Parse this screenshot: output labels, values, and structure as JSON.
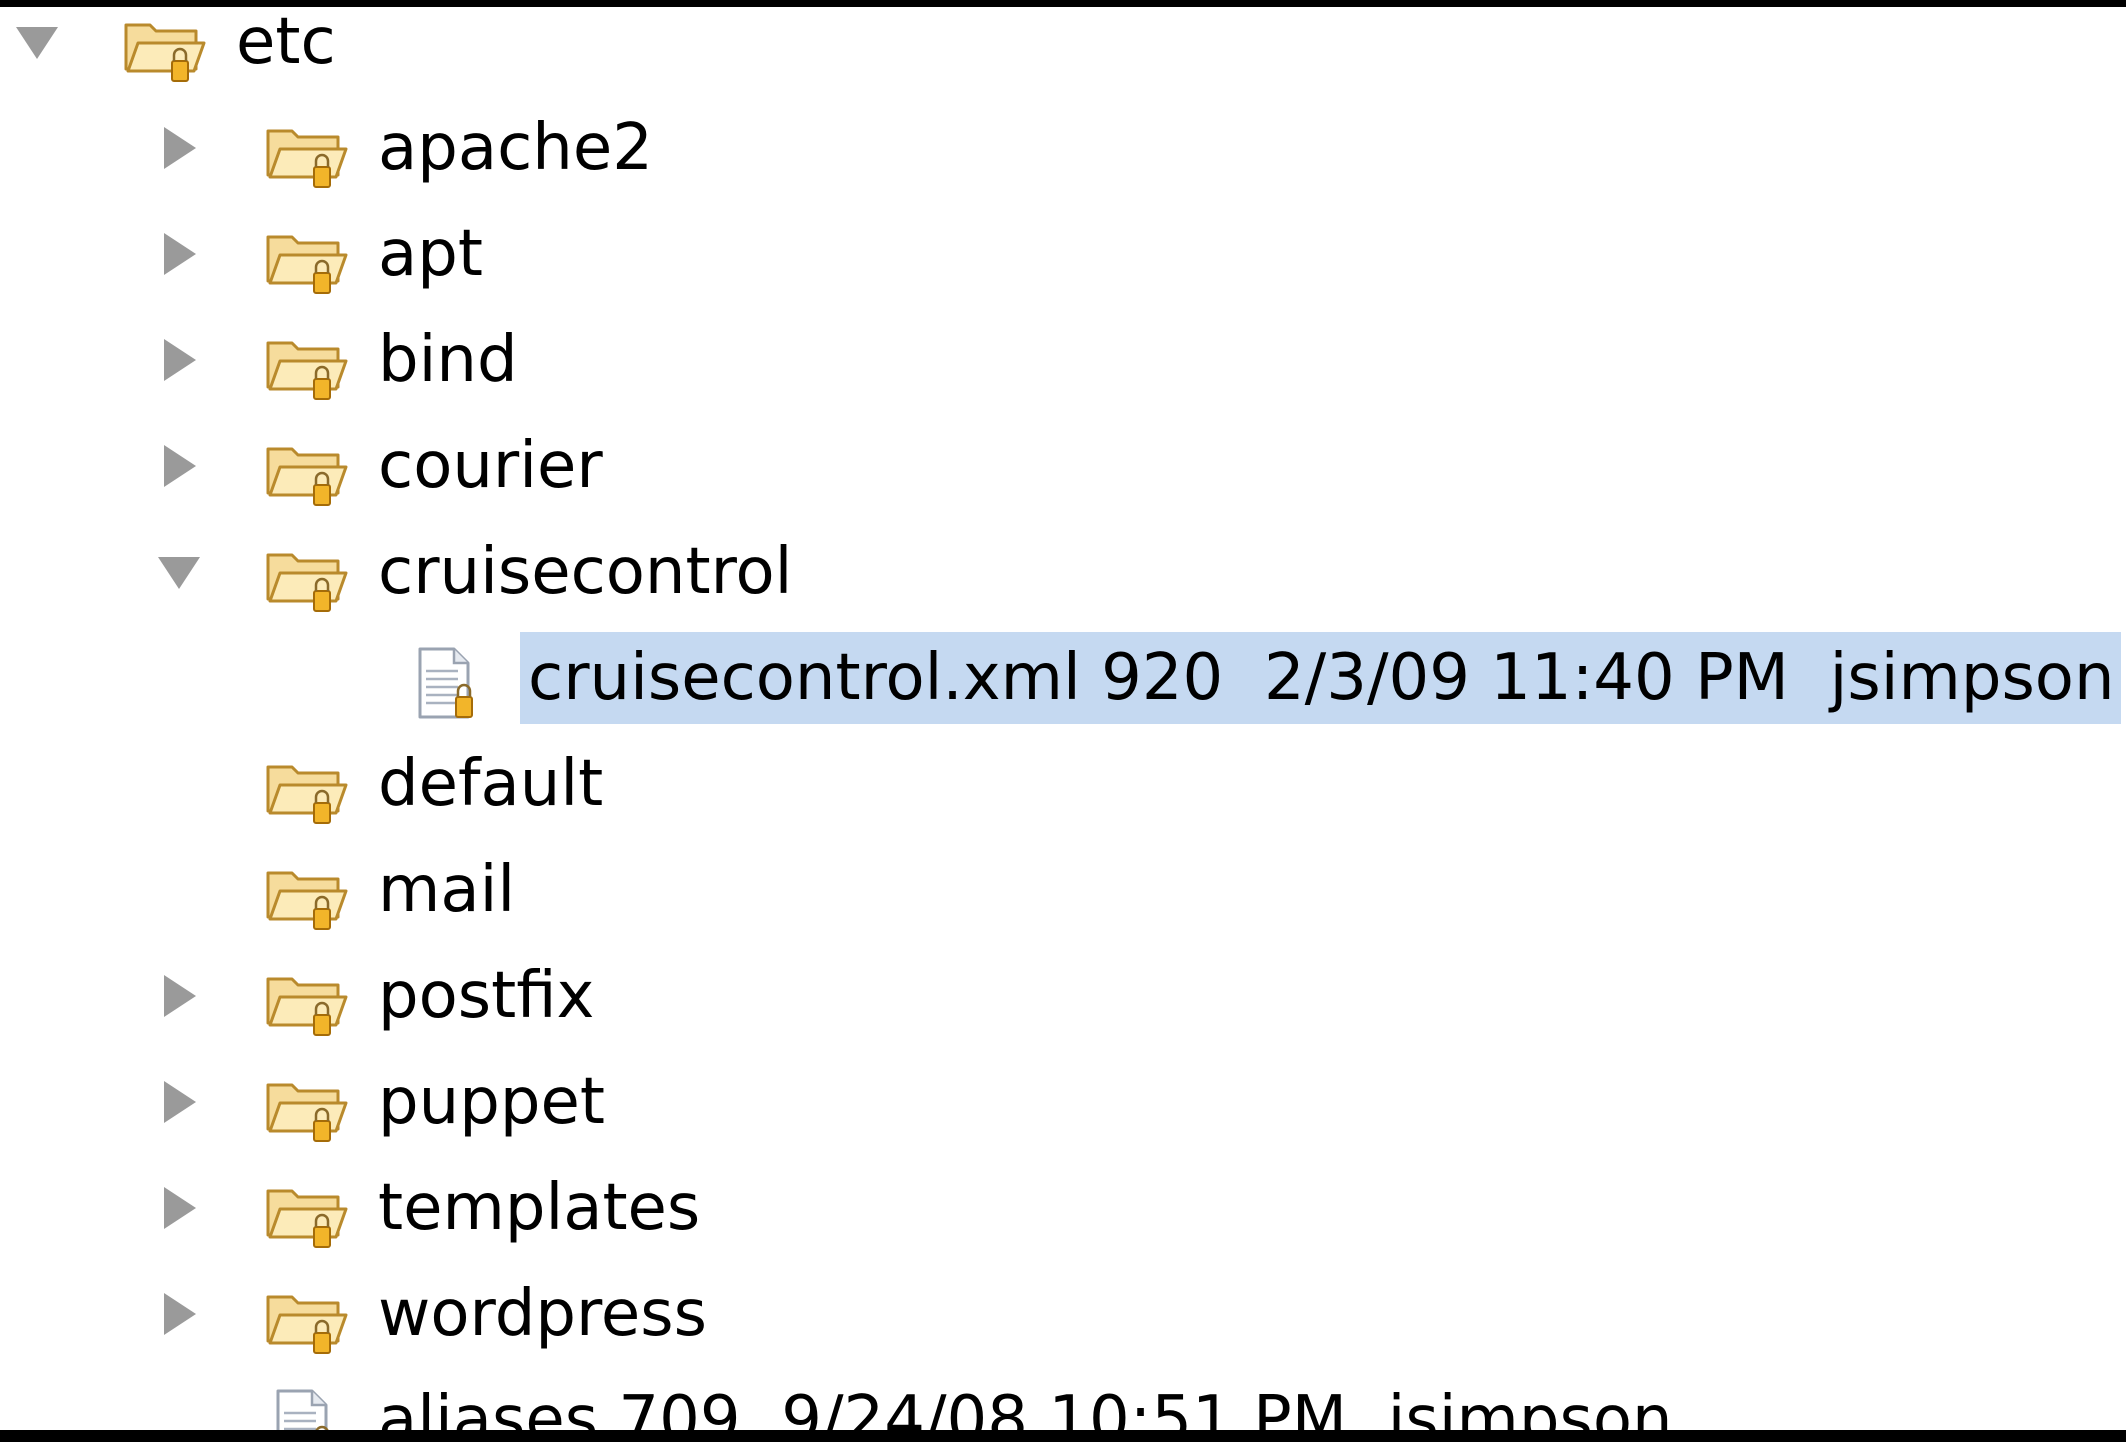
{
  "tree": {
    "rows": [
      {
        "label": "etc",
        "kind": "folder",
        "twisty": "expanded",
        "level": 0
      },
      {
        "label": "apache2",
        "kind": "folder",
        "twisty": "collapsed",
        "level": 1
      },
      {
        "label": "apt",
        "kind": "folder",
        "twisty": "collapsed",
        "level": 1
      },
      {
        "label": "bind",
        "kind": "folder",
        "twisty": "collapsed",
        "level": 1
      },
      {
        "label": "courier",
        "kind": "folder",
        "twisty": "collapsed",
        "level": 1
      },
      {
        "label": "cruisecontrol",
        "kind": "folder",
        "twisty": "expanded",
        "level": 1
      },
      {
        "label": "cruisecontrol.xml 920  2/3/09 11:40 PM  jsimpson",
        "kind": "file",
        "twisty": "none",
        "level": 2,
        "selected": true
      },
      {
        "label": "default",
        "kind": "folder",
        "twisty": "none",
        "level": 1
      },
      {
        "label": "mail",
        "kind": "folder",
        "twisty": "none",
        "level": 1
      },
      {
        "label": "postfix",
        "kind": "folder",
        "twisty": "collapsed",
        "level": 1
      },
      {
        "label": "puppet",
        "kind": "folder",
        "twisty": "collapsed",
        "level": 1
      },
      {
        "label": "templates",
        "kind": "folder",
        "twisty": "collapsed",
        "level": 1
      },
      {
        "label": "wordpress",
        "kind": "folder",
        "twisty": "collapsed",
        "level": 1
      },
      {
        "label": "aliases 709  9/24/08 10:51 PM  jsimpson",
        "kind": "file",
        "twisty": "none",
        "level": 1
      }
    ]
  },
  "colors": {
    "selection": "#c5d9f1",
    "folder_fill": "#f6dc9c",
    "folder_stroke": "#b98a2c",
    "lock_fill": "#f2b52a",
    "twisty": "#9a9a9a"
  },
  "icons": {
    "expanded": "triangle-down-icon",
    "collapsed": "triangle-right-icon",
    "folder": "folder-icon",
    "file": "file-icon",
    "lock": "lock-icon"
  }
}
